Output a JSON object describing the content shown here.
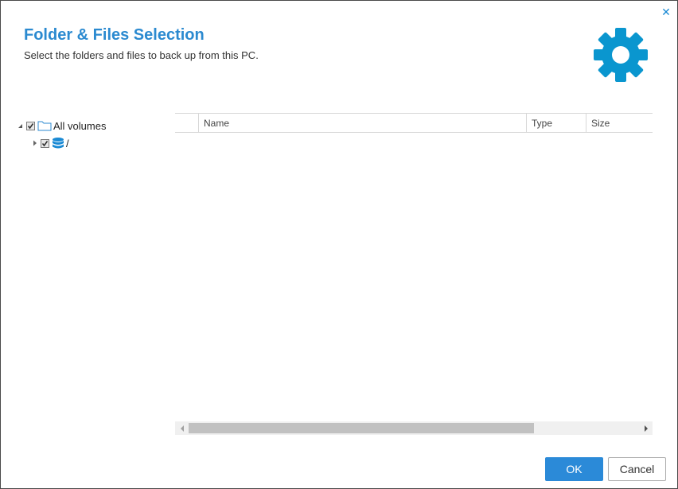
{
  "dialog": {
    "title": "Folder & Files Selection",
    "subtitle": "Select the folders and files to back up from this PC.",
    "close_icon": "close-icon",
    "header_icon": "gear-icon",
    "accent_color": "#2b8ad0",
    "gear_color": "#0a96cf"
  },
  "tree": {
    "items": [
      {
        "label": "All volumes",
        "expanded": true,
        "checked": true,
        "icon": "folder-icon"
      },
      {
        "label": "/",
        "expanded": false,
        "checked": true,
        "icon": "database-icon"
      }
    ]
  },
  "grid": {
    "columns": [
      {
        "label": ""
      },
      {
        "label": "Name"
      },
      {
        "label": "Type"
      },
      {
        "label": "Size"
      }
    ],
    "rows": []
  },
  "buttons": {
    "ok": "OK",
    "cancel": "Cancel"
  }
}
